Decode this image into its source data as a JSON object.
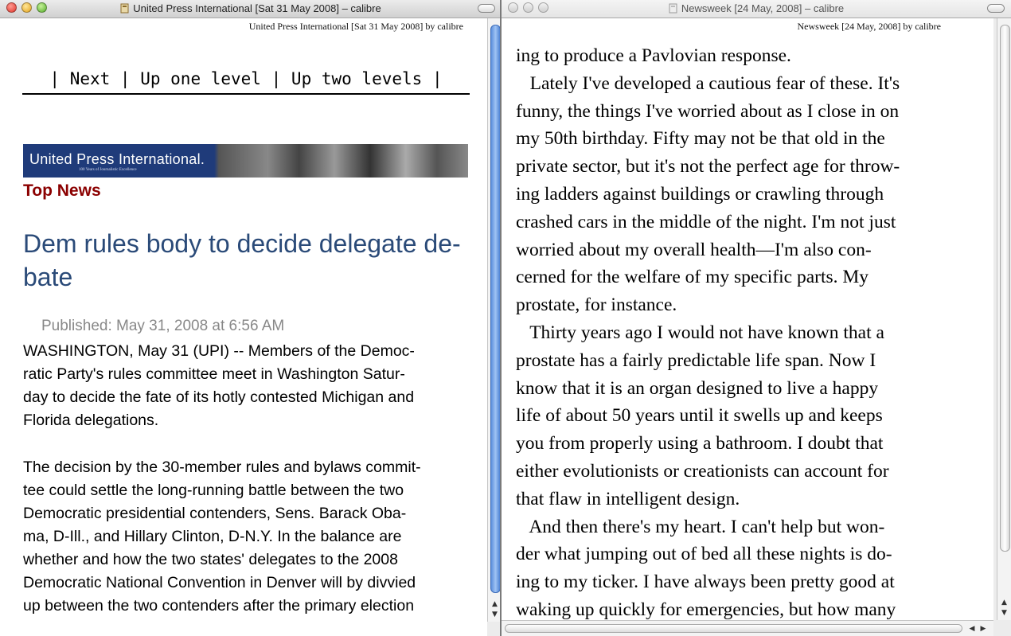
{
  "left_window": {
    "title": "United Press International [Sat 31 May 2008] – calibre",
    "header": "United Press International [Sat 31 May 2008] by calibre",
    "nav": {
      "sep": "|",
      "next": "Next",
      "up_one": "Up one level",
      "up_two": "Up two levels"
    },
    "banner": {
      "text": "United Press International.",
      "subtext": "100 Years of Journalistic Excellence"
    },
    "section": "Top News",
    "headline": "Dem rules body to decide delegate de-\nbate",
    "published": "Published: May 31, 2008 at 6:56 AM",
    "para1": "WASHINGTON, May 31 (UPI) -- Members of the Democ-\nratic Party's rules committee meet in Washington Satur-\nday to decide the fate of its hotly contested Michigan and\nFlorida delegations.",
    "para2": "The decision by the 30-member rules and bylaws commit-\ntee could settle the long-running battle between the two\nDemocratic presidential contenders, Sens. Barack Oba-\nma, D-Ill., and Hillary Clinton, D-N.Y. In the balance are\nwhether and how the two states' delegates to the 2008\nDemocratic National Convention in Denver will by divvied\nup between the two contenders after the primary election"
  },
  "right_window": {
    "title": "Newsweek [24 May, 2008] – calibre",
    "header": "Newsweek [24 May, 2008] by calibre",
    "body": "ing to produce a Pavlovian response.\n   Lately I've developed a cautious fear of these. It's\nfunny, the things I've worried about as I close in on\nmy 50th birthday. Fifty may not be that old in the\nprivate sector, but it's not the perfect age for throw-\ning ladders against buildings or crawling through\ncrashed cars in the middle of the night. I'm not just\nworried about my overall health—I'm also con-\ncerned for the welfare of my specific parts. My\nprostate, for instance.\n   Thirty years ago I would not have known that a\nprostate has a fairly predictable life span. Now I\nknow that it is an organ designed to live a happy\nlife of about 50 years until it swells up and keeps\nyou from properly using a bathroom. I doubt that\neither evolutionists or creationists can account for\nthat flaw in intelligent design.\n   And then there's my heart. I can't help but won-\nder what jumping out of bed all these nights is do-\ning to my ticker. I have always been pretty good at\nwaking up quickly for emergencies, but how many"
  },
  "icons": {
    "close": "close-button",
    "minimize": "minimize-button",
    "zoom": "zoom-button",
    "doc": "document-icon"
  },
  "colors": {
    "headline": "#2a4a78",
    "section": "#8b0000",
    "active_scroll": "#5c8fdc"
  }
}
